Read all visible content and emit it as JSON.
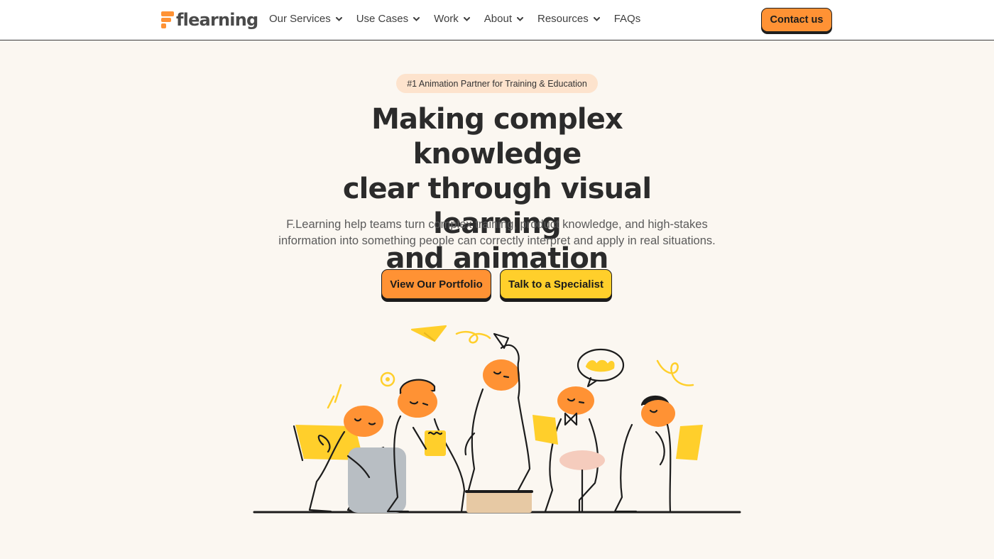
{
  "brand": {
    "name": "flearning",
    "logo_icon": "f-logo-icon",
    "accent": "#ff9234",
    "secondary": "#ffcf2b"
  },
  "nav": {
    "items": [
      {
        "label": "Our Services",
        "has_dropdown": true
      },
      {
        "label": "Use Cases",
        "has_dropdown": true
      },
      {
        "label": "Work",
        "has_dropdown": true
      },
      {
        "label": "About",
        "has_dropdown": true
      },
      {
        "label": "Resources",
        "has_dropdown": true
      },
      {
        "label": "FAQs",
        "has_dropdown": false
      }
    ],
    "contact_label": "Contact us"
  },
  "hero": {
    "badge": "#1 Animation Partner for Training & Education",
    "headline_lines": [
      "Making complex knowledge",
      "clear through visual learning",
      "and animation"
    ],
    "subtext_lines": [
      "F.Learning help teams turn complex training, product knowledge, and high-stakes",
      "information into something people can correctly interpret and apply in real situations."
    ],
    "primary_cta": "View Our Portfolio",
    "secondary_cta": "Talk to a Specialist",
    "illustration": "people-learning-illustration"
  }
}
